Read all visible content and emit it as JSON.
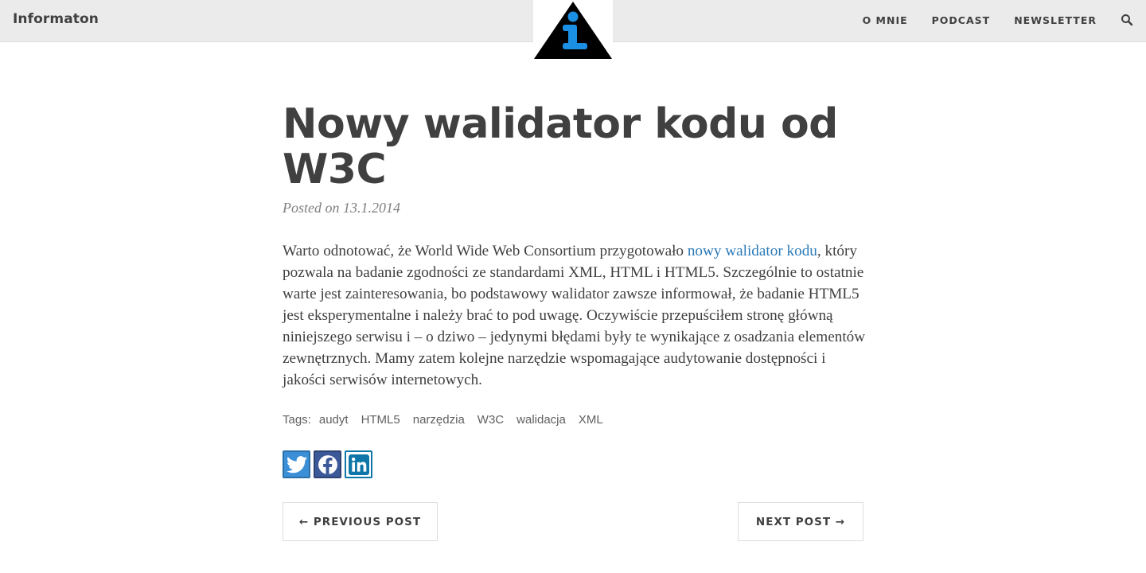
{
  "navbar": {
    "brand": "Informaton",
    "links": [
      "O MNIE",
      "PODCAST",
      "NEWSLETTER"
    ],
    "search_icon": "search-icon"
  },
  "logo": {
    "icon": "info-triangle-icon",
    "colors": {
      "triangle": "#000000",
      "info": "#1a8fe3"
    }
  },
  "post": {
    "title": "Nowy walidator kodu od W3C",
    "meta": "Posted on 13.1.2014",
    "body_before_link": "Warto odnotować, że World Wide Web Consortium przygotowało ",
    "link_text": "nowy walidator kodu",
    "body_after_link": ", który pozwala na badanie zgodności ze standardami XML, HTML i HTML5. Szczególnie to ostatnie warte jest zainteresowania, bo podstawowy walidator zawsze informował, że badanie HTML5 jest eksperymentalne i należy brać to pod uwagę. Oczywiście przepuściłem stronę główną niniejszego serwisu i – o dziwo – jedynymi błędami były te wynikające z osadzania elementów zewnętrznych. Mamy zatem kolejne narzędzie wspomagające audytowanie dostępności i jakości serwisów internetowych."
  },
  "tags": {
    "label": "Tags:",
    "items": [
      "audyt",
      "HTML5",
      "narzędzia",
      "W3C",
      "walidacja",
      "XML"
    ]
  },
  "share": {
    "twitter_icon": "twitter-icon",
    "facebook_icon": "facebook-icon",
    "linkedin_icon": "linkedin-icon"
  },
  "pager": {
    "previous": "← PREVIOUS POST",
    "next": "NEXT POST →"
  },
  "colors": {
    "navbar_bg": "#ebebeb",
    "text": "#404040",
    "link": "#2a7ab8"
  }
}
